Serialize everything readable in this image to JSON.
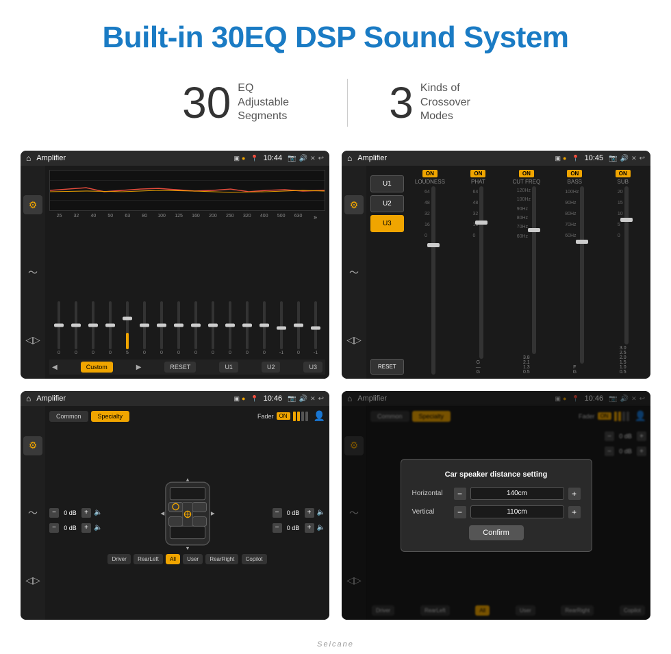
{
  "page": {
    "title": "Built-in 30EQ DSP Sound System",
    "stats": [
      {
        "number": "30",
        "label": "EQ Adjustable\nSegments"
      },
      {
        "number": "3",
        "label": "Kinds of\nCrossover Modes"
      }
    ]
  },
  "screen1": {
    "statusBar": {
      "title": "Amplifier",
      "time": "10:44"
    },
    "chart": "EQ curve",
    "freqLabels": [
      "25",
      "32",
      "40",
      "50",
      "63",
      "80",
      "100",
      "125",
      "160",
      "200",
      "250",
      "320",
      "400",
      "500",
      "630"
    ],
    "sliderValues": [
      "0",
      "0",
      "0",
      "0",
      "5",
      "0",
      "0",
      "0",
      "0",
      "0",
      "0",
      "0",
      "0",
      "-1",
      "0",
      "-1"
    ],
    "bottomButtons": [
      "Custom",
      "RESET",
      "U1",
      "U2",
      "U3"
    ]
  },
  "screen2": {
    "statusBar": {
      "title": "Amplifier",
      "time": "10:45"
    },
    "presets": [
      "U1",
      "U2",
      "U3"
    ],
    "activePreset": "U3",
    "resetBtn": "RESET",
    "channels": [
      {
        "label": "LOUDNESS",
        "on": true
      },
      {
        "label": "PHAT",
        "on": true
      },
      {
        "label": "CUT FREQ",
        "on": true
      },
      {
        "label": "BASS",
        "on": true
      },
      {
        "label": "SUB",
        "on": true
      }
    ]
  },
  "screen3": {
    "statusBar": {
      "title": "Amplifier",
      "time": "10:46"
    },
    "tabs": [
      "Common",
      "Specialty"
    ],
    "activeTab": "Specialty",
    "fader": {
      "label": "Fader",
      "badge": "ON"
    },
    "volControls": {
      "topLeft": "0 dB",
      "bottomLeft": "0 dB",
      "topRight": "0 dB",
      "bottomRight": "0 dB"
    },
    "seatButtons": [
      "Driver",
      "RearLeft",
      "All",
      "User",
      "RearRight",
      "Copilot"
    ]
  },
  "screen4": {
    "statusBar": {
      "title": "Amplifier",
      "time": "10:46"
    },
    "tabs": [
      "Common",
      "Specialty"
    ],
    "activeTab": "Specialty",
    "fader": {
      "label": "Fader",
      "badge": "ON"
    },
    "dialog": {
      "title": "Car speaker distance setting",
      "horizontal": {
        "label": "Horizontal",
        "value": "140cm"
      },
      "vertical": {
        "label": "Vertical",
        "value": "110cm"
      },
      "confirmBtn": "Confirm"
    },
    "volControls": {
      "topRight": "0 dB",
      "bottomRight": "0 dB"
    },
    "seatButtons": [
      "Driver",
      "RearLeft",
      "All",
      "User",
      "RearRight",
      "Copilot"
    ]
  },
  "brand": "Seicane"
}
